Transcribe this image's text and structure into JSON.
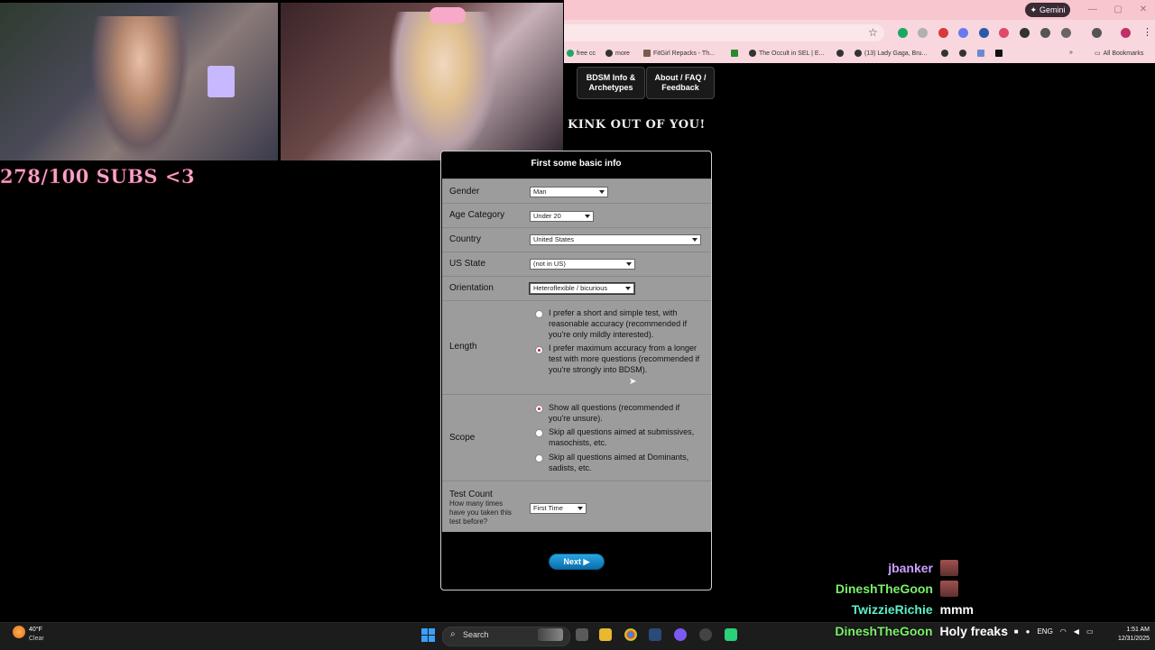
{
  "overlay": {
    "subs_text": "278/100 SUBS <3"
  },
  "browser": {
    "gemini_label": "Gemini",
    "bookmarks": [
      "free cc",
      "more",
      "FitGirl Repacks - Th...",
      "The Occult in SEL | E...",
      "(13) Lady Gaga, Bru...",
      "All Bookmarks"
    ]
  },
  "site": {
    "nav": [
      "BDSM Info & Archetypes",
      "About / FAQ / Feedback"
    ],
    "headline": "KINK OUT OF YOU!"
  },
  "form": {
    "title": "First some basic info",
    "gender": {
      "label": "Gender",
      "value": "Man"
    },
    "age": {
      "label": "Age Category",
      "value": "Under 20"
    },
    "country": {
      "label": "Country",
      "value": "United States"
    },
    "us_state": {
      "label": "US State",
      "value": "(not in US)"
    },
    "orientation": {
      "label": "Orientation",
      "value": "Heteroflexible / bicurious"
    },
    "length": {
      "label": "Length",
      "options": [
        {
          "text": "I prefer a short and simple test, with reasonable accuracy (recommended if you're only mildly interested).",
          "selected": false
        },
        {
          "text": "I prefer maximum accuracy from a longer test with more questions (recommended if you're strongly into BDSM).",
          "selected": true
        }
      ]
    },
    "scope": {
      "label": "Scope",
      "options": [
        {
          "text": "Show all questions (recommended if you're unsure).",
          "selected": true
        },
        {
          "text": "Skip all questions aimed at submissives, masochists, etc.",
          "selected": false
        },
        {
          "text": "Skip all questions aimed at Dominants, sadists, etc.",
          "selected": false
        }
      ]
    },
    "test_count": {
      "label": "Test Count",
      "sublabel": "How many times have you taken this test before?",
      "value": "First Time"
    },
    "next_label": "Next ▶"
  },
  "chat": [
    {
      "user": "jbanker",
      "color": "#c9a0ff",
      "message": "",
      "emote": true
    },
    {
      "user": "DineshTheGoon",
      "color": "#7cf06a",
      "message": "",
      "emote": true
    },
    {
      "user": "TwizzieRichie",
      "color": "#5af0c8",
      "message": "mmm",
      "emote": false
    },
    {
      "user": "DineshTheGoon",
      "color": "#7cf06a",
      "message": "Holy freaks",
      "emote": false
    }
  ],
  "taskbar": {
    "temp": "40°F",
    "condition": "Clear",
    "search_label": "Search",
    "lang": "ENG",
    "time": "1:51 AM",
    "date": "12/31/2025"
  },
  "colors": {
    "accent_pink": "#f7c6cf",
    "subs_pink": "#f4a6c8",
    "next_blue": "#1a8ccc"
  }
}
